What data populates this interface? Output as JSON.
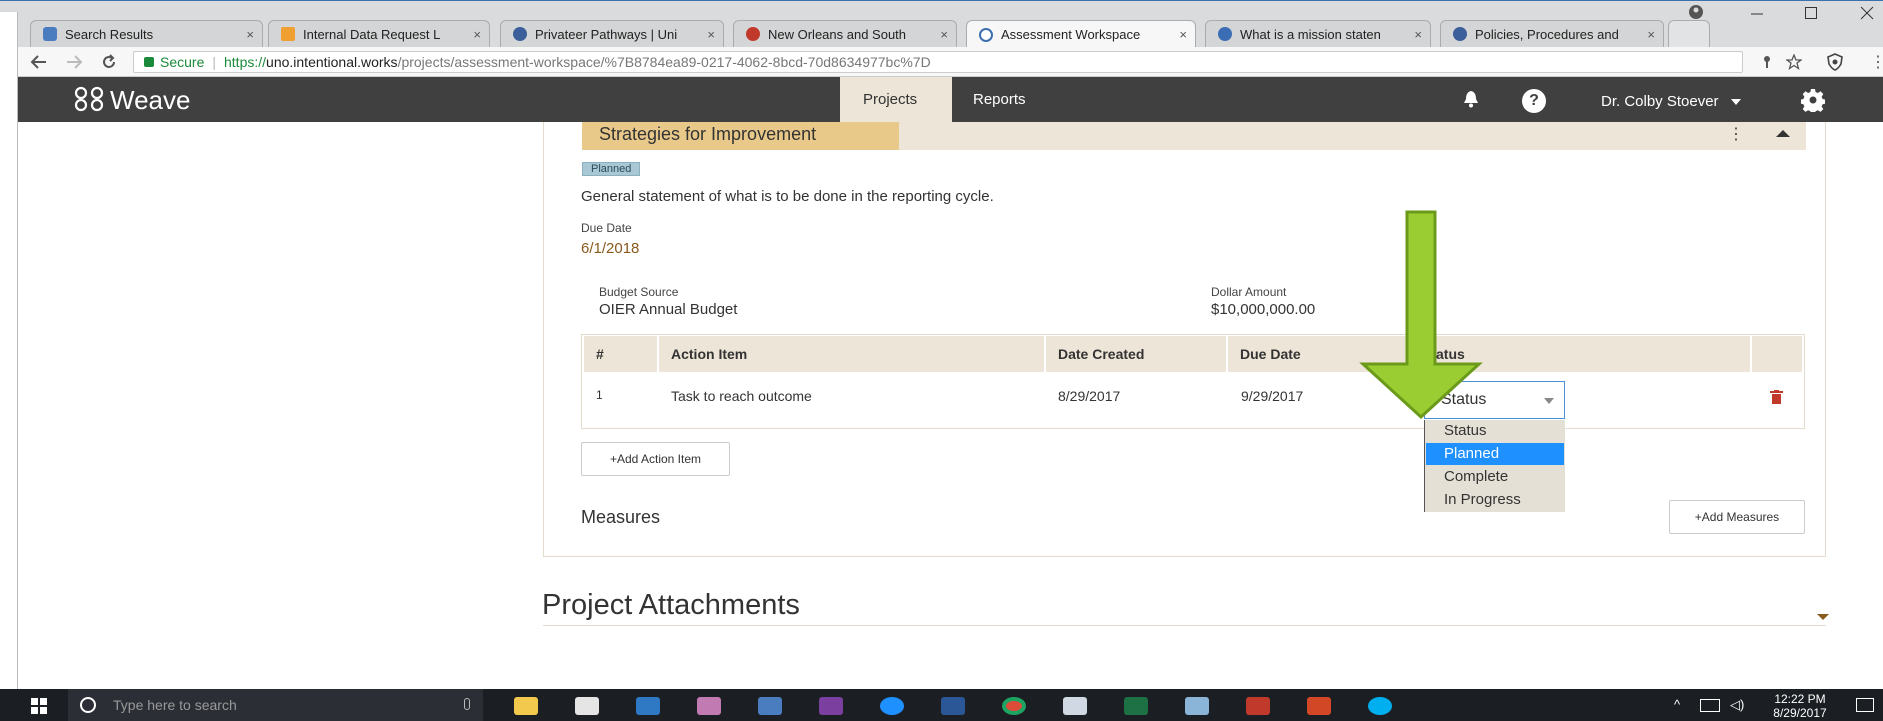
{
  "browser": {
    "tabs": [
      {
        "label": "Search Results",
        "icon": "shield-icon",
        "color": "#4a7cc0"
      },
      {
        "label": "Internal Data Request L",
        "icon": "orange-app-icon",
        "color": "#f0a030"
      },
      {
        "label": "Privateer Pathways | Uni",
        "icon": "seal-icon",
        "color": "#3a5f9a"
      },
      {
        "label": "New Orleans and South",
        "icon": "red-eye-icon",
        "color": "#c0392b"
      },
      {
        "label": "Assessment Workspace",
        "icon": "weave-icon",
        "color": "#3a6fb0"
      },
      {
        "label": "What is a mission staten",
        "icon": "blue-circle-icon",
        "color": "#3b6db5"
      },
      {
        "label": "Policies, Procedures and",
        "icon": "seal-icon",
        "color": "#3a5f9a"
      }
    ],
    "close_glyph": "×",
    "address": {
      "secure_label": "Secure",
      "url_scheme": "https://",
      "url_host": "uno.intentional.works",
      "url_path": "/projects/assessment-workspace/%7B8784ea89-0217-4062-8bcd-70d8634977bc%7D"
    }
  },
  "app": {
    "logo_text": "Weave",
    "nav": {
      "projects": "Projects",
      "reports": "Reports",
      "user": "Dr. Colby Stoever"
    }
  },
  "strategy": {
    "header": "Strategies for Improvement",
    "badge": "Planned",
    "statement": "General statement of what is to be done in the reporting cycle.",
    "due_date_label": "Due Date",
    "due_date_value": "6/1/2018",
    "budget_source_label": "Budget Source",
    "budget_source_value": "OIER Annual Budget",
    "dollar_amount_label": "Dollar Amount",
    "dollar_amount_value": "$10,000,000.00"
  },
  "action_table": {
    "headers": [
      "#",
      "Action Item",
      "Date Created",
      "Due Date",
      "Status"
    ],
    "rows": [
      {
        "num": "1",
        "action_item": "Task to reach outcome",
        "date_created": "8/29/2017",
        "due_date": "9/29/2017",
        "status": "Status"
      }
    ],
    "status_options": [
      "Status",
      "Planned",
      "Complete",
      "In Progress"
    ],
    "status_highlighted": "Planned"
  },
  "buttons": {
    "add_action_item": "+Add Action Item",
    "add_measures": "+Add Measures"
  },
  "sections": {
    "measures": "Measures",
    "project_attachments": "Project Attachments"
  },
  "taskbar": {
    "search_placeholder": "Type here to search",
    "time": "12:22 PM",
    "date": "8/29/2017"
  },
  "colors": {
    "nav_bg": "#404040",
    "accent_gold": "#e8c98a",
    "header_tan": "#ede5d7",
    "badge_blue": "#a9c7d4",
    "dropdown_highlight": "#1e90ff",
    "arrow_green": "#9acd32",
    "delete_red": "#c0392b"
  }
}
